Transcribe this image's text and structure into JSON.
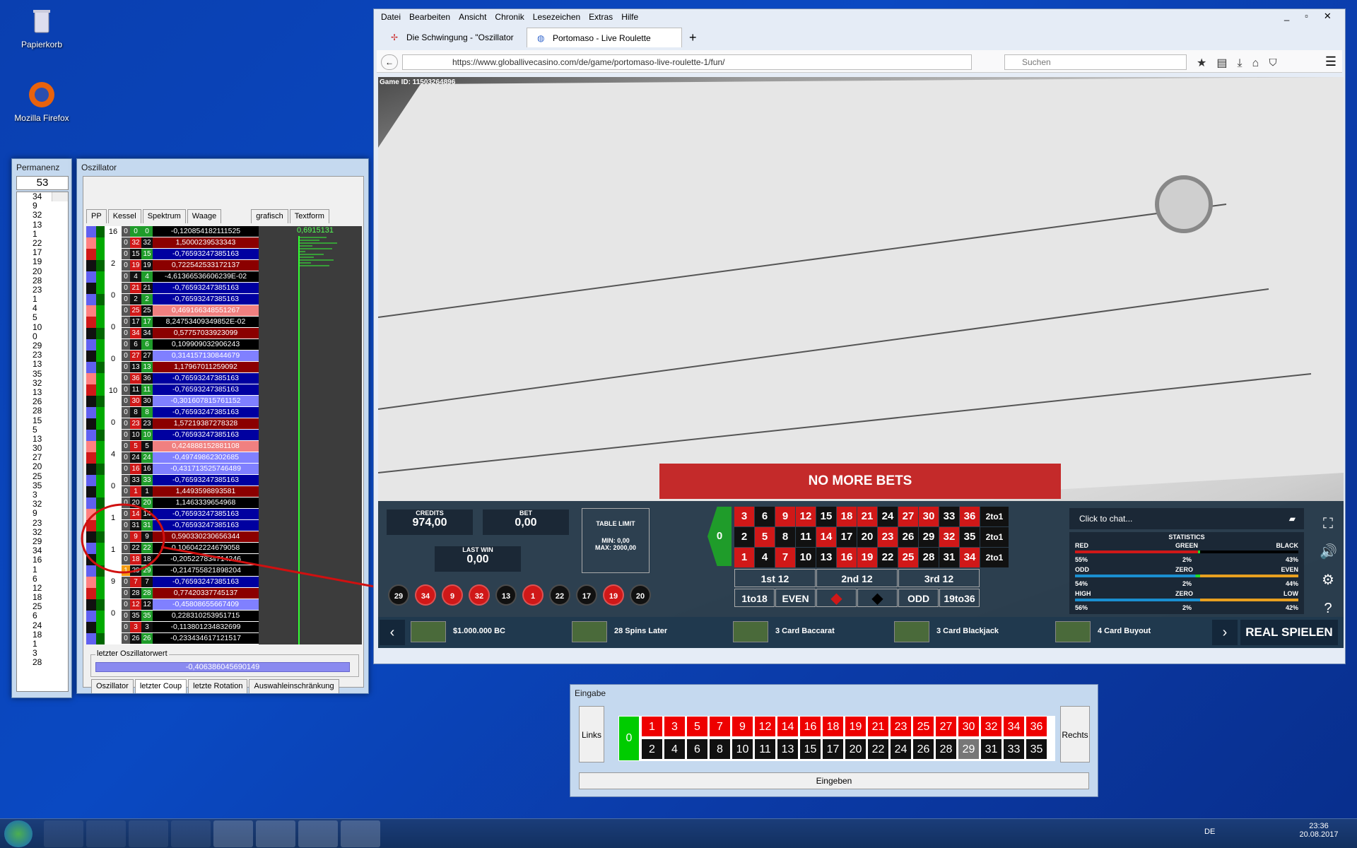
{
  "desktop": {
    "recycle_bin": "Papierkorb",
    "firefox": "Mozilla Firefox"
  },
  "permanenz": {
    "title": "Permanenz",
    "count": "53",
    "list": [
      "34",
      "9",
      "32",
      "13",
      "1",
      "22",
      "17",
      "19",
      "20",
      "28",
      "23",
      "1",
      "4",
      "5",
      "10",
      "0",
      "29",
      "23",
      "13",
      "35",
      "32",
      "13",
      "26",
      "28",
      "15",
      "5",
      "13",
      "30",
      "27",
      "20",
      "25",
      "35",
      "3",
      "32",
      "9",
      "23",
      "32",
      "29",
      "34",
      "16",
      "1",
      "6",
      "12",
      "18",
      "25",
      "6",
      "24",
      "18",
      "1",
      "3",
      "28"
    ]
  },
  "oszillator": {
    "title": "Oszillator",
    "tabs_top": [
      "PP",
      "Kessel",
      "Spektrum",
      "Waage",
      "grafisch",
      "Textform"
    ],
    "graph_value": "0,6915131",
    "pp_numbers": [
      "16",
      "2",
      "0",
      "0",
      "0",
      "10",
      "0",
      "4",
      "0",
      "1",
      "1",
      "9",
      "0"
    ],
    "rows": [
      {
        "z": "0",
        "n": "0",
        "v": "-0,120854182111525",
        "c": "#000000",
        "nc": "grn"
      },
      {
        "z": "0",
        "n": "32",
        "v": "1,5000239533343",
        "c": "#8b0000",
        "nc": "red"
      },
      {
        "z": "0",
        "n": "15",
        "v": "-0,76593247385163",
        "c": "#0000a0",
        "nc": "blk"
      },
      {
        "z": "0",
        "n": "19",
        "v": "0,722542533172137",
        "c": "#8b0000",
        "nc": "red"
      },
      {
        "z": "0",
        "n": "4",
        "v": "-4,61366536606239E-02",
        "c": "#000000",
        "nc": "blk"
      },
      {
        "z": "0",
        "n": "21",
        "v": "-0,76593247385163",
        "c": "#0000a0",
        "nc": "red"
      },
      {
        "z": "0",
        "n": "2",
        "v": "-0,76593247385163",
        "c": "#0000a0",
        "nc": "blk"
      },
      {
        "z": "0",
        "n": "25",
        "v": "0,469166348551267",
        "c": "#f08080",
        "nc": "red"
      },
      {
        "z": "0",
        "n": "17",
        "v": "8,24753409349852E-02",
        "c": "#000000",
        "nc": "blk"
      },
      {
        "z": "0",
        "n": "34",
        "v": "0,57757033923099",
        "c": "#8b0000",
        "nc": "red"
      },
      {
        "z": "0",
        "n": "6",
        "v": "0,109909032906243",
        "c": "#000000",
        "nc": "blk"
      },
      {
        "z": "0",
        "n": "27",
        "v": "0,314157130844679",
        "c": "#8080ff",
        "nc": "red"
      },
      {
        "z": "0",
        "n": "13",
        "v": "1,17967011259092",
        "c": "#8b0000",
        "nc": "blk"
      },
      {
        "z": "0",
        "n": "36",
        "v": "-0,76593247385163",
        "c": "#0000a0",
        "nc": "red"
      },
      {
        "z": "0",
        "n": "11",
        "v": "-0,76593247385163",
        "c": "#0000a0",
        "nc": "blk"
      },
      {
        "z": "0",
        "n": "30",
        "v": "-0,301607815761152",
        "c": "#8080ff",
        "nc": "red"
      },
      {
        "z": "0",
        "n": "8",
        "v": "-0,76593247385163",
        "c": "#0000a0",
        "nc": "blk"
      },
      {
        "z": "0",
        "n": "23",
        "v": "1,57219387278328",
        "c": "#8b0000",
        "nc": "red"
      },
      {
        "z": "0",
        "n": "10",
        "v": "-0,76593247385163",
        "c": "#0000a0",
        "nc": "blk"
      },
      {
        "z": "0",
        "n": "5",
        "v": "0,424888152881108",
        "c": "#f08080",
        "nc": "red"
      },
      {
        "z": "0",
        "n": "24",
        "v": "-0,49749862302685",
        "c": "#8080ff",
        "nc": "blk"
      },
      {
        "z": "0",
        "n": "16",
        "v": "-0,431713525746489",
        "c": "#8080ff",
        "nc": "red"
      },
      {
        "z": "0",
        "n": "33",
        "v": "-0,76593247385163",
        "c": "#0000a0",
        "nc": "blk"
      },
      {
        "z": "0",
        "n": "1",
        "v": "1,4493598893581",
        "c": "#8b0000",
        "nc": "red"
      },
      {
        "z": "0",
        "n": "20",
        "v": "1,1463339654968",
        "c": "#000000",
        "nc": "blk"
      },
      {
        "z": "0",
        "n": "14",
        "v": "-0,76593247385163",
        "c": "#0000a0",
        "nc": "red"
      },
      {
        "z": "0",
        "n": "31",
        "v": "-0,76593247385163",
        "c": "#0000a0",
        "nc": "blk"
      },
      {
        "z": "0",
        "n": "9",
        "v": "0,590330230656344",
        "c": "#8b0000",
        "nc": "red"
      },
      {
        "z": "0",
        "n": "22",
        "v": "0,106042224679058",
        "c": "#000000",
        "nc": "blk"
      },
      {
        "z": "0",
        "n": "18",
        "v": "-0,205227834714246",
        "c": "#000000",
        "nc": "red"
      },
      {
        "z": "1",
        "n": "29",
        "v": "-0,214755821898204",
        "c": "#000000",
        "nc": "blk"
      },
      {
        "z": "0",
        "n": "7",
        "v": "-0,76593247385163",
        "c": "#0000a0",
        "nc": "red"
      },
      {
        "z": "0",
        "n": "28",
        "v": "0,77420337745137",
        "c": "#8b0000",
        "nc": "blk"
      },
      {
        "z": "0",
        "n": "12",
        "v": "-0,45808655667409",
        "c": "#8080ff",
        "nc": "red"
      },
      {
        "z": "0",
        "n": "35",
        "v": "0,228310253951715",
        "c": "#000000",
        "nc": "blk"
      },
      {
        "z": "0",
        "n": "3",
        "v": "-0,113801234832699",
        "c": "#000000",
        "nc": "red"
      },
      {
        "z": "0",
        "n": "26",
        "v": "-0,233434617121517",
        "c": "#000000",
        "nc": "blk"
      }
    ],
    "group_label": "letzter Oszillatorwert",
    "last_value": "-0,406386045690149",
    "tabs_bottom": [
      "Oszillator",
      "letzter Coup",
      "letzte Rotation",
      "Auswahleinschränkung"
    ]
  },
  "browser": {
    "menu": [
      "Datei",
      "Bearbeiten",
      "Ansicht",
      "Chronik",
      "Lesezeichen",
      "Extras",
      "Hilfe"
    ],
    "tab1": "Die Schwingung - \"Oszillator",
    "tab2": "Portomaso - Live Roulette",
    "url": "https://www.globallivecasino.com/de/game/portomaso-live-roulette-1/fun/",
    "search_placeholder": "Suchen",
    "game_id": "Game ID: 11503264896"
  },
  "casino": {
    "credits_label": "CREDITS",
    "credits": "974,00",
    "bet_label": "BET",
    "bet": "0,00",
    "lastwin_label": "LAST WIN",
    "lastwin": "0,00",
    "table_limit": "TABLE LIMIT",
    "min": "MIN: 0,00",
    "max": "MAX: 2000,00",
    "no_more_bets": "NO MORE BETS",
    "history": [
      "29",
      "34",
      "9",
      "32",
      "13",
      "1",
      "22",
      "17",
      "19",
      "20"
    ],
    "history_colors": [
      "blk",
      "red",
      "red",
      "red",
      "blk",
      "red",
      "blk",
      "blk",
      "red",
      "blk"
    ],
    "row3": [
      "3",
      "6",
      "9",
      "12",
      "15",
      "18",
      "21",
      "24",
      "27",
      "30",
      "33",
      "36"
    ],
    "row2": [
      "2",
      "5",
      "8",
      "11",
      "14",
      "17",
      "20",
      "23",
      "26",
      "29",
      "32",
      "35"
    ],
    "row1": [
      "1",
      "4",
      "7",
      "10",
      "13",
      "16",
      "19",
      "22",
      "25",
      "28",
      "31",
      "34"
    ],
    "zero": "0",
    "two_to_one": "2to1",
    "dozens": [
      "1st 12",
      "2nd 12",
      "3rd 12"
    ],
    "outside": [
      "1to18",
      "EVEN",
      "ODD",
      "19to36"
    ],
    "chat": "Click to chat...",
    "statistics": "STATISTICS",
    "stats": [
      {
        "l": "RED",
        "m": "GREEN",
        "r": "BLACK",
        "lv": "55%",
        "mv": "2%",
        "rv": "43%"
      },
      {
        "l": "ODD",
        "m": "ZERO",
        "r": "EVEN",
        "lv": "54%",
        "mv": "2%",
        "rv": "44%"
      },
      {
        "l": "HIGH",
        "m": "ZERO",
        "r": "LOW",
        "lv": "56%",
        "mv": "2%",
        "rv": "42%"
      }
    ],
    "games": [
      "$1.000.000 BC",
      "28 Spins Later",
      "3 Card Baccarat",
      "3 Card Blackjack",
      "4 Card Buyout"
    ],
    "real": "REAL SPIELEN"
  },
  "eingabe": {
    "title": "Eingabe",
    "left": "Links",
    "right": "Rechts",
    "zero": "0",
    "top": [
      "1",
      "3",
      "5",
      "7",
      "9",
      "12",
      "14",
      "16",
      "18",
      "19",
      "21",
      "23",
      "25",
      "27",
      "30",
      "32",
      "34",
      "36"
    ],
    "bottom": [
      "2",
      "4",
      "6",
      "8",
      "10",
      "11",
      "13",
      "15",
      "17",
      "20",
      "22",
      "24",
      "26",
      "28",
      "29",
      "31",
      "33",
      "35"
    ],
    "submit": "Eingeben"
  },
  "taskbar": {
    "lang": "DE",
    "time": "23:36",
    "date": "20.08.2017"
  }
}
